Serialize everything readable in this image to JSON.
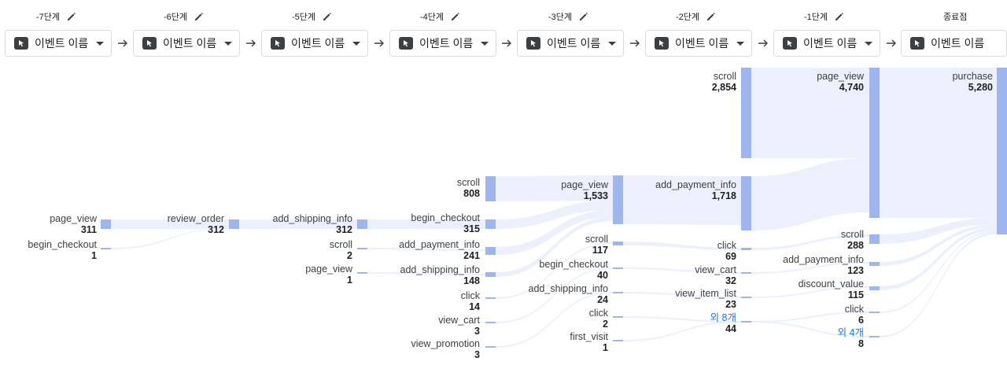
{
  "steps": [
    {
      "label": "-7단계",
      "dropdown": "이벤트 이름",
      "editable": true
    },
    {
      "label": "-6단계",
      "dropdown": "이벤트 이름",
      "editable": true
    },
    {
      "label": "-5단계",
      "dropdown": "이벤트 이름",
      "editable": true
    },
    {
      "label": "-4단계",
      "dropdown": "이벤트 이름",
      "editable": true
    },
    {
      "label": "-3단계",
      "dropdown": "이벤트 이름",
      "editable": true
    },
    {
      "label": "-2단계",
      "dropdown": "이벤트 이름",
      "editable": true
    },
    {
      "label": "-1단계",
      "dropdown": "이벤트 이름",
      "editable": true
    },
    {
      "label": "종료점",
      "dropdown": "이벤트 이름",
      "editable": false
    }
  ],
  "columns": [
    [
      {
        "name": "page_view",
        "value": "311"
      },
      {
        "name": "begin_checkout",
        "value": "1"
      }
    ],
    [
      {
        "name": "review_order",
        "value": "312"
      }
    ],
    [
      {
        "name": "add_shipping_info",
        "value": "312"
      },
      {
        "name": "scroll",
        "value": "2"
      },
      {
        "name": "page_view",
        "value": "1"
      }
    ],
    [
      {
        "name": "scroll",
        "value": "808"
      },
      {
        "name": "begin_checkout",
        "value": "315"
      },
      {
        "name": "add_payment_info",
        "value": "241"
      },
      {
        "name": "add_shipping_info",
        "value": "148"
      },
      {
        "name": "click",
        "value": "14"
      },
      {
        "name": "view_cart",
        "value": "3"
      },
      {
        "name": "view_promotion",
        "value": "3"
      }
    ],
    [
      {
        "name": "page_view",
        "value": "1,533"
      },
      {
        "name": "scroll",
        "value": "117"
      },
      {
        "name": "begin_checkout",
        "value": "40"
      },
      {
        "name": "add_shipping_info",
        "value": "24"
      },
      {
        "name": "click",
        "value": "2"
      },
      {
        "name": "first_visit",
        "value": "1"
      }
    ],
    [
      {
        "name": "scroll",
        "value": "2,854"
      },
      {
        "name": "add_payment_info",
        "value": "1,718"
      },
      {
        "name": "click",
        "value": "69"
      },
      {
        "name": "view_cart",
        "value": "32"
      },
      {
        "name": "view_item_list",
        "value": "23"
      },
      {
        "name": "외 8개",
        "value": "44",
        "more": true
      }
    ],
    [
      {
        "name": "page_view",
        "value": "4,740"
      },
      {
        "name": "scroll",
        "value": "288"
      },
      {
        "name": "add_payment_info",
        "value": "123"
      },
      {
        "name": "discount_value",
        "value": "115"
      },
      {
        "name": "click",
        "value": "6"
      },
      {
        "name": "외 4개",
        "value": "8",
        "more": true
      }
    ],
    [
      {
        "name": "purchase",
        "value": "5,280"
      }
    ]
  ],
  "colors": {
    "node": "#9fb5ef",
    "flow": "#e8edfb",
    "link": "#1a73e8"
  }
}
